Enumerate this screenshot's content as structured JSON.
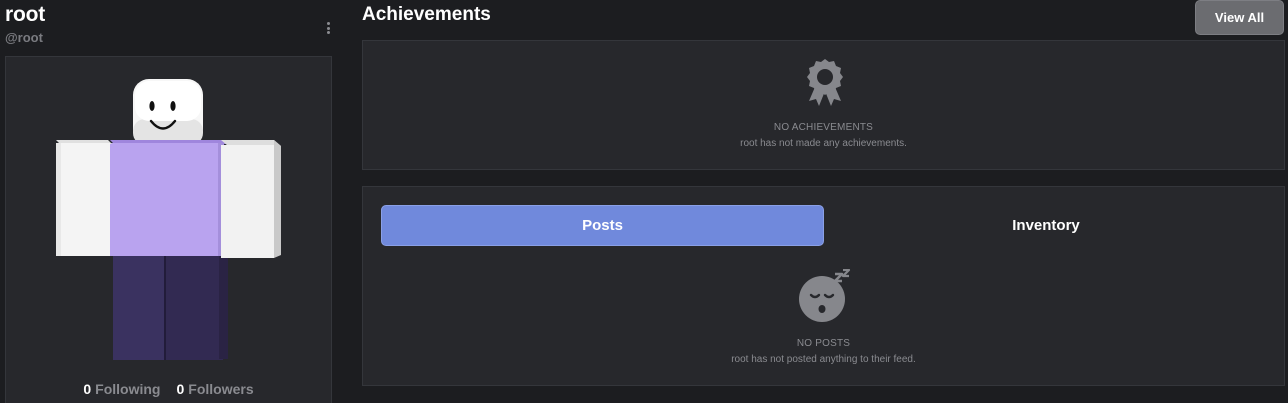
{
  "profile": {
    "display_name": "root",
    "handle": "@root",
    "following_count": "0",
    "following_label": "Following",
    "followers_count": "0",
    "followers_label": "Followers"
  },
  "achievements": {
    "title": "Achievements",
    "view_all_label": "View All",
    "empty_title": "NO ACHIEVEMENTS",
    "empty_message": "root has not made any achievements.",
    "icon": "award-ribbon-icon"
  },
  "feed": {
    "tabs": [
      {
        "label": "Posts",
        "active": true
      },
      {
        "label": "Inventory",
        "active": false
      }
    ],
    "empty_title": "NO POSTS",
    "empty_message": "root has not posted anything to their feed.",
    "icon": "sleeping-face-icon"
  },
  "colors": {
    "page_bg": "#1c1d20",
    "panel_bg": "#27282c",
    "accent": "#7089dc",
    "muted_text": "#8a8b90",
    "avatar_shirt": "#b8a2ee",
    "avatar_pants": "#3a3358"
  }
}
